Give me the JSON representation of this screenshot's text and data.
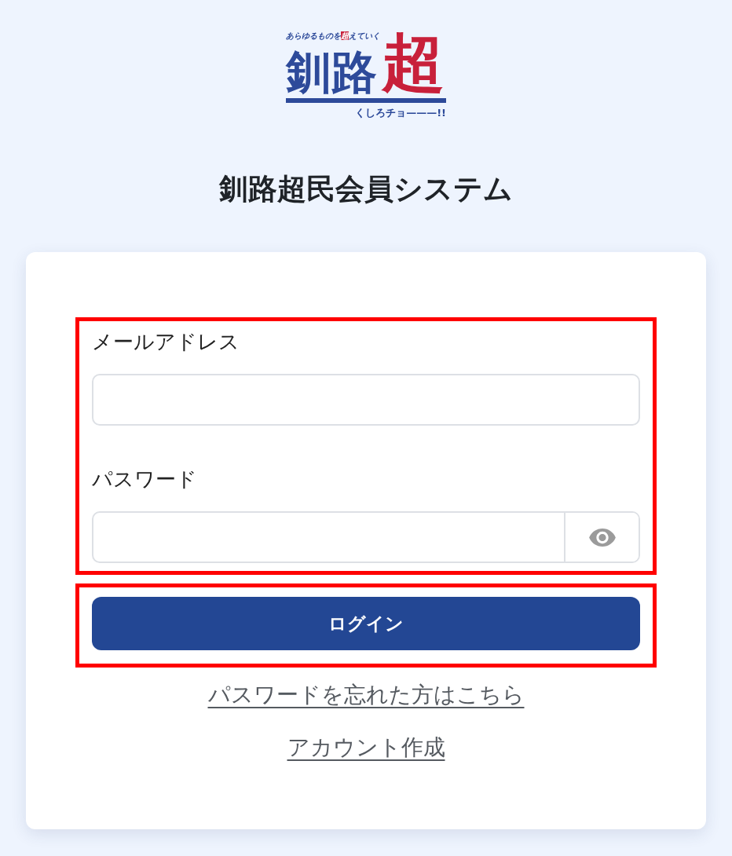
{
  "logo": {
    "tagline": {
      "before": "あらゆるものを",
      "highlight": "超",
      "after": "えていく"
    },
    "wordmark": {
      "text": "釧路",
      "accent": "超"
    },
    "reading": "くしろチョ———!!"
  },
  "title": "釧路超民会員システム",
  "form": {
    "highlighted": true,
    "fields": [
      {
        "kind": "text",
        "label": "メールアドレス"
      },
      {
        "kind": "password",
        "label": "パスワード"
      }
    ]
  },
  "login_button": {
    "label": "ログイン",
    "highlighted": true
  },
  "links": [
    "パスワードを忘れた方はこちら",
    "アカウント作成"
  ]
}
